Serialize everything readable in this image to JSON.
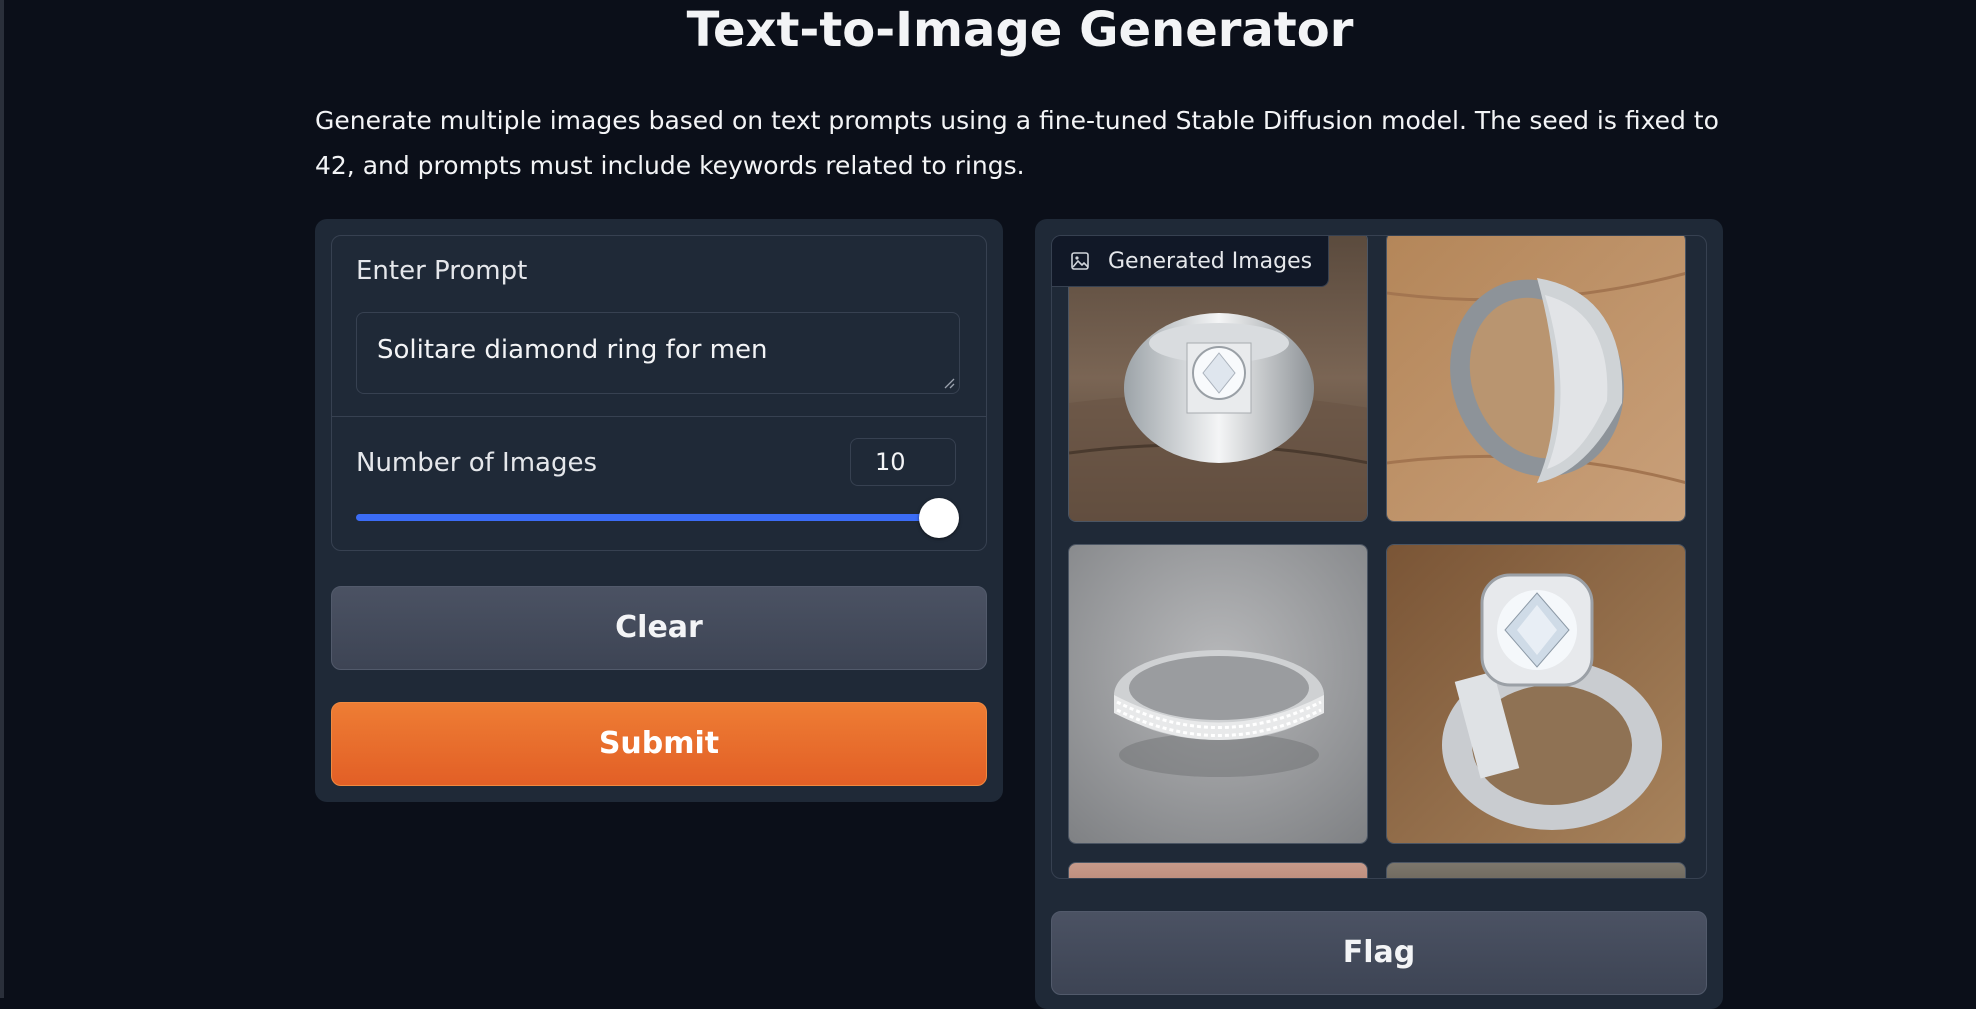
{
  "header": {
    "title": "Text-to-Image Generator",
    "description": "Generate multiple images based on text prompts using a fine-tuned Stable Diffusion model. The seed is fixed to 42, and prompts must include keywords related to rings."
  },
  "form": {
    "prompt_label": "Enter Prompt",
    "prompt_value": "Solitare diamond ring for men",
    "num_images_label": "Number of Images",
    "num_images_value": "10",
    "slider_fraction": 1.0,
    "clear_label": "Clear",
    "submit_label": "Submit"
  },
  "gallery": {
    "label": "Generated Images",
    "label_icon": "image-icon",
    "images": [
      {
        "description": "silver ring with solitaire diamond on wood"
      },
      {
        "description": "silver band with textured diamond inlay on wood"
      },
      {
        "description": "diamond eternity band on grey background"
      },
      {
        "description": "silver ring with large diamond on brown background"
      }
    ]
  },
  "actions": {
    "flag_label": "Flag"
  },
  "colors": {
    "background": "#0b0f19",
    "panel": "#1f2937",
    "slider_accent": "#3b6cf6",
    "submit_orange": "#e8692c"
  }
}
